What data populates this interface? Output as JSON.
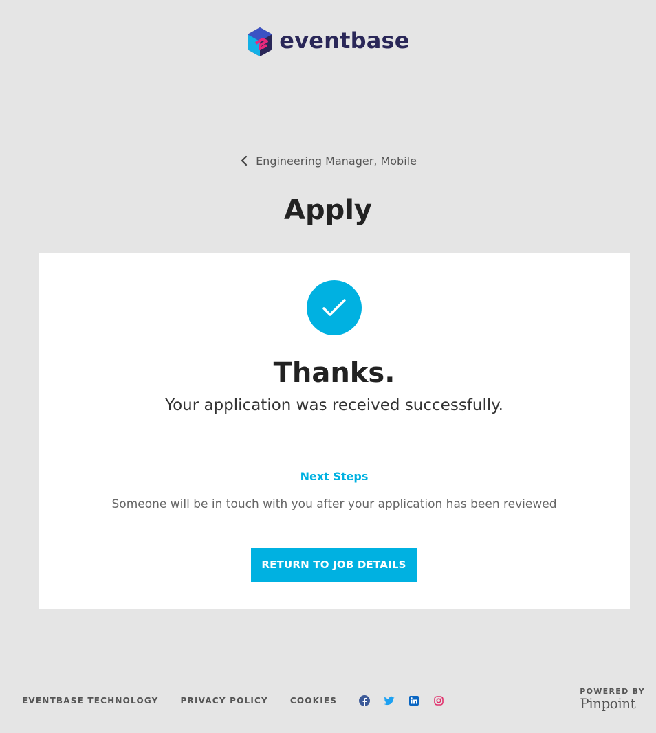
{
  "header": {
    "logo_text": "eventbase",
    "logo_icon": "eventbase-hexagon-logo"
  },
  "breadcrumb": {
    "back_icon": "chevron-left-icon",
    "link_text": "Engineering Manager, Mobile"
  },
  "page": {
    "title": "Apply"
  },
  "confirmation": {
    "icon": "checkmark-circle-icon",
    "heading": "Thanks.",
    "message": "Your application was received successfully.",
    "next_steps_title": "Next Steps",
    "next_steps_text": "Someone will be in touch with you after your application has been reviewed",
    "button_label": "RETURN TO JOB DETAILS"
  },
  "footer": {
    "links": [
      "EVENTBASE TECHNOLOGY",
      "PRIVACY POLICY",
      "COOKIES"
    ],
    "socials": [
      "facebook-icon",
      "twitter-icon",
      "linkedin-icon",
      "instagram-icon"
    ],
    "powered_by": "POWERED BY",
    "powered_brand": "Pinpoint"
  },
  "colors": {
    "background": "#e5e5e5",
    "accent": "#00b1e1",
    "logo_text": "#2a2758",
    "card": "#ffffff"
  }
}
